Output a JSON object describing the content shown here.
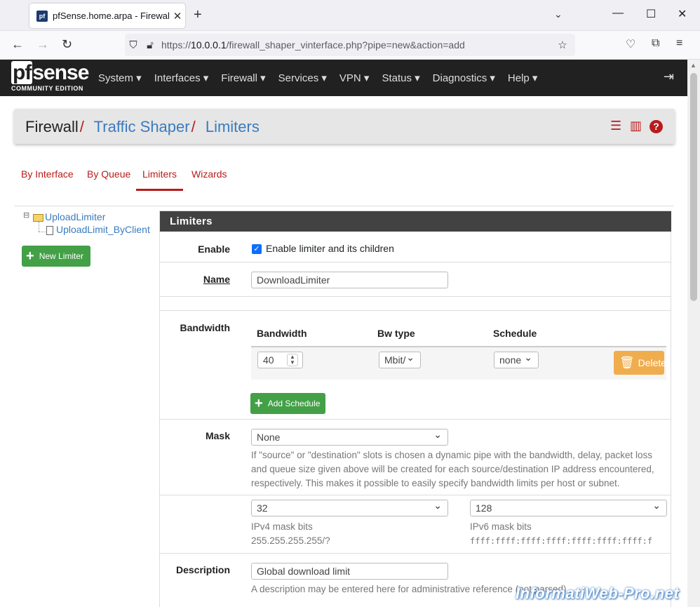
{
  "browser": {
    "tab_title": "pfSense.home.arpa - Firewall: Tr",
    "url_prefix": "https://",
    "url_host": "10.0.0.1",
    "url_path": "/firewall_shaper_vinterface.php?pipe=new&action=add"
  },
  "pf": {
    "logo_top": "sense",
    "logo_pf": "pf",
    "logo_edition": "COMMUNITY EDITION",
    "menu": [
      "System ▾",
      "Interfaces ▾",
      "Firewall ▾",
      "Services ▾",
      "VPN ▾",
      "Status ▾",
      "Diagnostics ▾",
      "Help ▾"
    ]
  },
  "breadcrumb": {
    "part1": "Firewall",
    "part2": "Traffic Shaper",
    "part3": "Limiters",
    "separator": "/"
  },
  "subtabs": [
    "By Interface",
    "By Queue",
    "Limiters",
    "Wizards"
  ],
  "tree": {
    "root": "UploadLimiter",
    "child": "UploadLimit_ByClient",
    "new_button": "New Limiter",
    "expander": "⊟"
  },
  "panel": {
    "title": "Limiters",
    "enable_label": "Enable",
    "enable_text": "Enable limiter and its children",
    "name_label": "Name",
    "name_value": "DownloadLimiter",
    "bandwidth_label": "Bandwidth",
    "col_bandwidth": "Bandwidth",
    "col_bwtype": "Bw type",
    "col_schedule": "Schedule",
    "bw_value": "40",
    "bw_type": "Mbit/",
    "schedule": "none",
    "delete_button": "Delete",
    "add_schedule_button": "Add Schedule",
    "mask_label": "Mask",
    "mask_value": "None",
    "mask_help": "If \"source\" or \"destination\" slots is chosen a dynamic pipe with the bandwidth, delay, packet loss and queue size given above will be created for each source/destination IP address encountered, respectively. This makes it possible to easily specify bandwidth limits per host or subnet.",
    "ipv4_value": "32",
    "ipv4_label": "IPv4 mask bits",
    "ipv4_hint": "255.255.255.255/?",
    "ipv6_value": "128",
    "ipv6_label": "IPv6 mask bits",
    "ipv6_hint": "ffff:ffff:ffff:ffff:ffff:ffff:ffff:f",
    "description_label": "Description",
    "description_value": "Global download limit",
    "description_help": "A description may be entered here for administrative reference (not parsed)."
  },
  "watermark": "InformatiWeb-Pro.net",
  "colors": {
    "accent_red": "#b71c1c",
    "link_blue": "#3b7bbf",
    "green": "#43a047",
    "orange": "#f0ad4e",
    "dark": "#212121"
  }
}
